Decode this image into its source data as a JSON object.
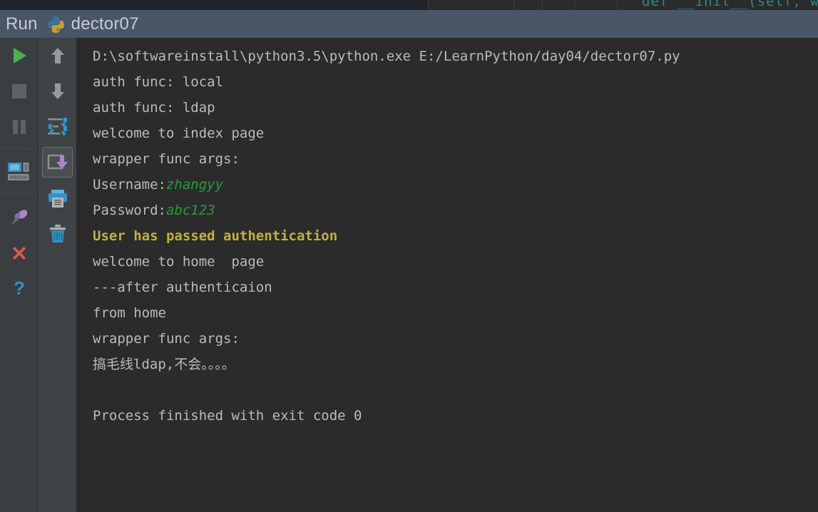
{
  "window": {
    "tool_window_title": "Run",
    "run_configuration_name": "dector07",
    "python_icon": "python-logo-icon",
    "titlebar_color": "#485668"
  },
  "editor_sliver": {
    "visible_code_fragment": "def __init__(self, wrapper"
  },
  "left_toolbar": {
    "buttons": [
      {
        "name": "rerun-button",
        "tooltip": "Rerun",
        "icon": "play-icon",
        "color": "#4caf50",
        "state": "enabled"
      },
      {
        "name": "stop-button",
        "tooltip": "Stop",
        "icon": "stop-square-icon",
        "color": "#5f6365",
        "state": "disabled"
      },
      {
        "name": "pause-button",
        "tooltip": "Pause Output",
        "icon": "pause-icon",
        "color": "#5f6365",
        "state": "disabled"
      },
      {
        "name": "layout-settings-button",
        "tooltip": "Layout Settings",
        "icon": "console-layout-icon",
        "color": "#3592c4",
        "state": "enabled"
      },
      {
        "name": "pin-tab-button",
        "tooltip": "Pin Tab",
        "icon": "pin-icon",
        "color": "#b184cd",
        "state": "enabled"
      },
      {
        "name": "close-button",
        "tooltip": "Close",
        "icon": "close-x-icon",
        "color": "#e05b4b",
        "state": "enabled"
      },
      {
        "name": "help-button",
        "tooltip": "Help",
        "icon": "question-mark-icon",
        "color": "#3592c4",
        "state": "enabled"
      }
    ]
  },
  "secondary_toolbar": {
    "buttons": [
      {
        "name": "up-the-stack-button",
        "tooltip": "Up the Stack Trace",
        "icon": "arrow-up-icon",
        "color": "#9a9a9a",
        "state": "enabled"
      },
      {
        "name": "down-the-stack-button",
        "tooltip": "Down the Stack Trace",
        "icon": "arrow-down-icon",
        "color": "#9a9a9a",
        "state": "enabled"
      },
      {
        "name": "soft-wrap-button",
        "tooltip": "Use Soft Wraps",
        "icon": "soft-wrap-icon",
        "color": "#3592c4",
        "state": "enabled"
      },
      {
        "name": "scroll-to-end-button",
        "tooltip": "Scroll to the end",
        "icon": "scroll-to-end-icon",
        "color": "#b184cd",
        "state": "toggled"
      },
      {
        "name": "print-button",
        "tooltip": "Print",
        "icon": "printer-icon",
        "color": "#3592c4",
        "state": "enabled"
      },
      {
        "name": "clear-all-button",
        "tooltip": "Clear All",
        "icon": "trash-icon",
        "color": "#3592c4",
        "state": "enabled"
      }
    ]
  },
  "console": {
    "background": "#2b2b2b",
    "text_color": "#bbbbbb",
    "input_color": "#2a9a3f",
    "highlight_color": "#c4b040",
    "lines": [
      {
        "id": "line-command",
        "text": "D:\\softwareinstall\\python3.5\\python.exe E:/LearnPython/day04/dector07.py",
        "style": "normal"
      },
      {
        "id": "line-auth-local",
        "text": "auth func: local",
        "style": "normal"
      },
      {
        "id": "line-auth-ldap",
        "text": "auth func: ldap",
        "style": "normal"
      },
      {
        "id": "line-welcome-index",
        "text": "welcome to index page",
        "style": "normal"
      },
      {
        "id": "line-wrapper-args-1",
        "text": "wrapper func args:",
        "style": "normal"
      },
      {
        "id": "line-username",
        "prefix": "Username:",
        "input": "zhangyy",
        "style": "input"
      },
      {
        "id": "line-password",
        "prefix": "Password:",
        "input": "abc123",
        "style": "input"
      },
      {
        "id": "line-auth-passed",
        "text": "User has passed authentication",
        "style": "highlight"
      },
      {
        "id": "line-welcome-home",
        "text": "welcome to home  page",
        "style": "normal"
      },
      {
        "id": "line-after-auth",
        "text": "---after authenticaion",
        "style": "normal"
      },
      {
        "id": "line-from-home",
        "text": "from home",
        "style": "normal"
      },
      {
        "id": "line-wrapper-args-2",
        "text": "wrapper func args:",
        "style": "normal"
      },
      {
        "id": "line-chinese",
        "text": "搞毛线ldap,不会。。。。",
        "style": "normal"
      },
      {
        "id": "line-blank",
        "text": " ",
        "style": "blank"
      },
      {
        "id": "line-process-finished",
        "text": "Process finished with exit code 0",
        "style": "normal"
      }
    ]
  }
}
